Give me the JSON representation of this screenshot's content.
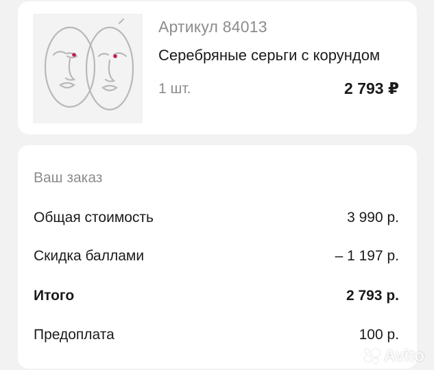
{
  "product": {
    "article": "Артикул 84013",
    "name": "Серебряные серьги с корундом",
    "quantity": "1 шт.",
    "price": "2 793 ₽",
    "image_icon": "earrings-face-icon"
  },
  "order": {
    "title": "Ваш заказ",
    "rows": [
      {
        "label": "Общая стоимость",
        "value": "3 990 р."
      },
      {
        "label": "Скидка баллами",
        "value": "– 1 197 р."
      },
      {
        "label": "Итого",
        "value": "2 793 р."
      },
      {
        "label": "Предоплата",
        "value": "100 р."
      }
    ]
  },
  "watermark": {
    "text": "Avito"
  },
  "colors": {
    "background": "#f2f2f2",
    "card": "#ffffff",
    "muted_text": "#8c8c8c",
    "text": "#1a1a1a",
    "gem": "#c2185b"
  }
}
